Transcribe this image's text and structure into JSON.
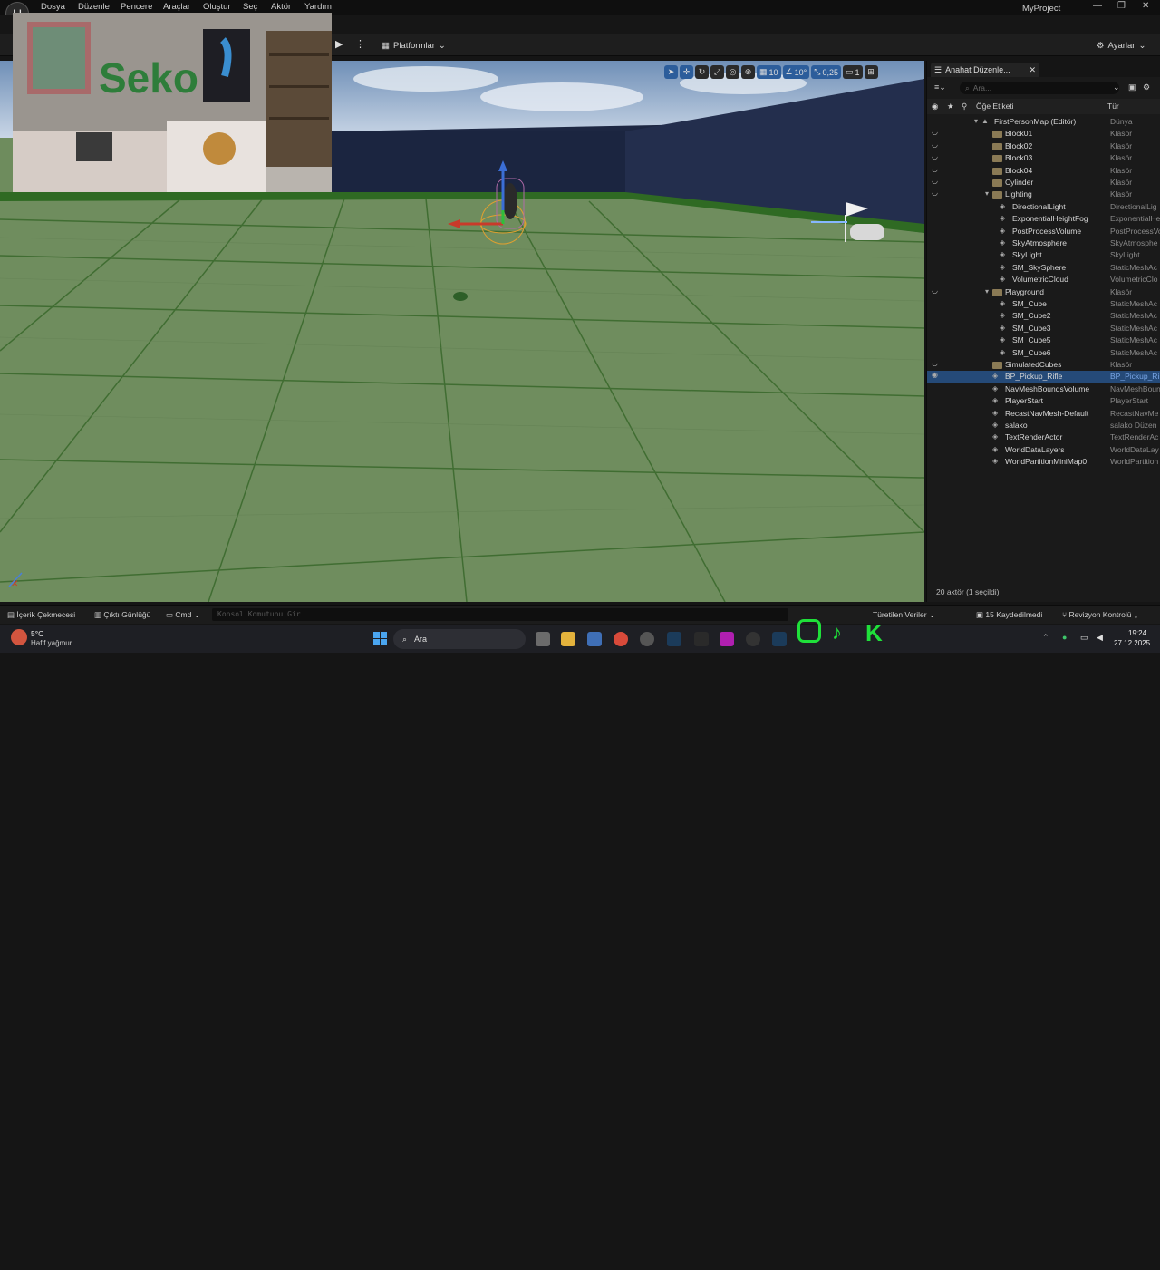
{
  "menu": [
    "Dosya",
    "Düzenle",
    "Pencere",
    "Araçlar",
    "Oluştur",
    "Seç",
    "Aktör",
    "Yardım"
  ],
  "project_name": "MyProject",
  "toolbar": {
    "platforms_label": "Platformlar",
    "settings_label": "Ayarlar"
  },
  "viewport_toolbar": {
    "grid_value": "10",
    "angle_value": "10°",
    "scale_value": "0,25",
    "camera_value": "1"
  },
  "outliner": {
    "tab_label": "Anahat Düzenle...",
    "search_placeholder": "Ara...",
    "col_label": "Öğe Etiketi",
    "col_type": "Tür",
    "rows": [
      {
        "label": "FirstPersonMap (Editör)",
        "type": "Dünya",
        "depth": 0,
        "kind": "world"
      },
      {
        "label": "Block01",
        "type": "Klasör",
        "depth": 1,
        "kind": "folder"
      },
      {
        "label": "Block02",
        "type": "Klasör",
        "depth": 1,
        "kind": "folder"
      },
      {
        "label": "Block03",
        "type": "Klasör",
        "depth": 1,
        "kind": "folder"
      },
      {
        "label": "Block04",
        "type": "Klasör",
        "depth": 1,
        "kind": "folder"
      },
      {
        "label": "Cylinder",
        "type": "Klasör",
        "depth": 1,
        "kind": "folder"
      },
      {
        "label": "Lighting",
        "type": "Klasör",
        "depth": 1,
        "kind": "folder-open"
      },
      {
        "label": "DirectionalLight",
        "type": "DirectionalLig",
        "depth": 2,
        "kind": "actor"
      },
      {
        "label": "ExponentialHeightFog",
        "type": "ExponentialHe",
        "depth": 2,
        "kind": "actor"
      },
      {
        "label": "PostProcessVolume",
        "type": "PostProcessVo",
        "depth": 2,
        "kind": "actor"
      },
      {
        "label": "SkyAtmosphere",
        "type": "SkyAtmosphe",
        "depth": 2,
        "kind": "actor"
      },
      {
        "label": "SkyLight",
        "type": "SkyLight",
        "depth": 2,
        "kind": "actor"
      },
      {
        "label": "SM_SkySphere",
        "type": "StaticMeshAc",
        "depth": 2,
        "kind": "actor"
      },
      {
        "label": "VolumetricCloud",
        "type": "VolumetricClo",
        "depth": 2,
        "kind": "actor"
      },
      {
        "label": "Playground",
        "type": "Klasör",
        "depth": 1,
        "kind": "folder-open"
      },
      {
        "label": "SM_Cube",
        "type": "StaticMeshAc",
        "depth": 2,
        "kind": "actor"
      },
      {
        "label": "SM_Cube2",
        "type": "StaticMeshAc",
        "depth": 2,
        "kind": "actor"
      },
      {
        "label": "SM_Cube3",
        "type": "StaticMeshAc",
        "depth": 2,
        "kind": "actor"
      },
      {
        "label": "SM_Cube5",
        "type": "StaticMeshAc",
        "depth": 2,
        "kind": "actor"
      },
      {
        "label": "SM_Cube6",
        "type": "StaticMeshAc",
        "depth": 2,
        "kind": "actor"
      },
      {
        "label": "SimulatedCubes",
        "type": "Klasör",
        "depth": 1,
        "kind": "folder"
      },
      {
        "label": "BP_Pickup_Rifle",
        "type": "BP_Pickup_Ri",
        "depth": 1,
        "kind": "actor",
        "selected": true
      },
      {
        "label": "NavMeshBoundsVolume",
        "type": "NavMeshBoun",
        "depth": 1,
        "kind": "actor"
      },
      {
        "label": "PlayerStart",
        "type": "PlayerStart",
        "depth": 1,
        "kind": "actor"
      },
      {
        "label": "RecastNavMesh-Default",
        "type": "RecastNavMe",
        "depth": 1,
        "kind": "actor"
      },
      {
        "label": "salako",
        "type": "salako Düzen",
        "depth": 1,
        "kind": "actor"
      },
      {
        "label": "TextRenderActor",
        "type": "TextRenderAc",
        "depth": 1,
        "kind": "actor"
      },
      {
        "label": "WorldDataLayers",
        "type": "WorldDataLay",
        "depth": 1,
        "kind": "actor"
      },
      {
        "label": "WorldPartitionMiniMap0",
        "type": "WorldPartition",
        "depth": 1,
        "kind": "actor"
      }
    ],
    "actor_count": "20 aktör (1 seçildi)"
  },
  "bottom": {
    "content_drawer": "İçerik Çekmecesi",
    "output_log": "Çıktı Günlüğü",
    "cmd": "Cmd",
    "console_placeholder": "Konsol Komutunu Gir",
    "derived": "Türetilen Veriler",
    "unsaved": "15 Kaydedilmedi",
    "revision": "Revizyon Kontrolü"
  },
  "taskbar": {
    "temp": "5°C",
    "weather": "Hafif yağmur",
    "search": "Ara",
    "time": "19:24",
    "date": "27.12.2025"
  },
  "webcam_wall_text": "Seko",
  "accent_colors": {
    "selection": "#254a78",
    "active_button": "#2c5d9b",
    "grass": "#6e8c5d"
  }
}
